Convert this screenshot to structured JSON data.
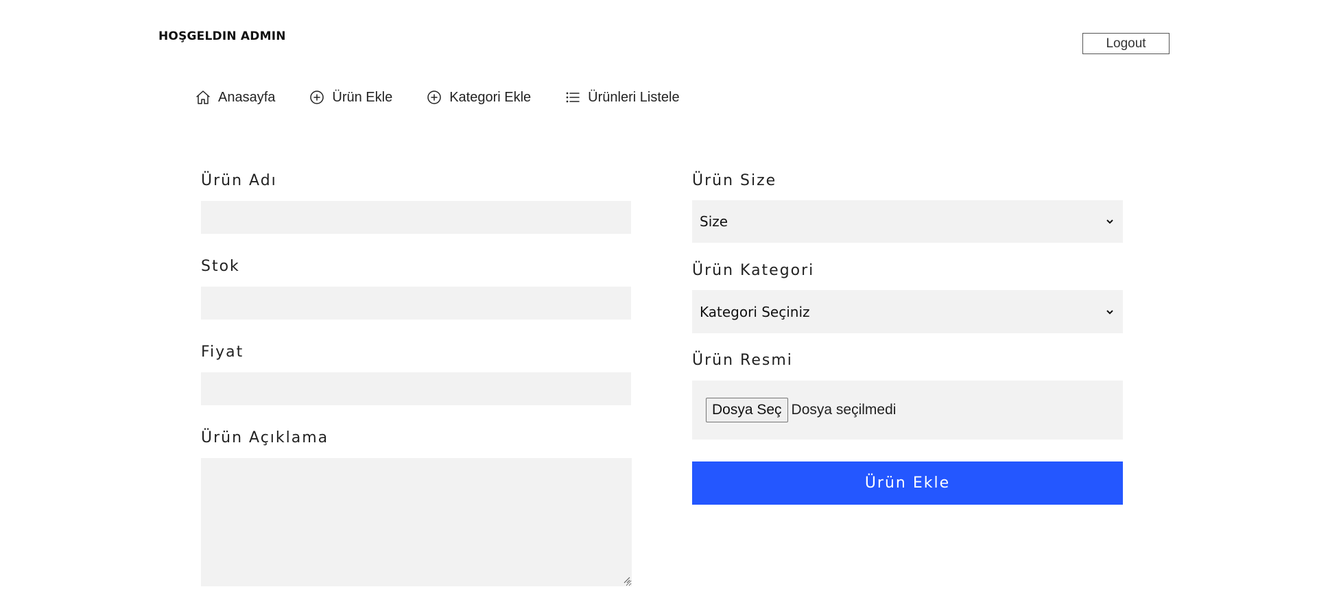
{
  "header": {
    "welcome": "HOŞGELDIN ADMIN",
    "logout_label": "Logout"
  },
  "nav": {
    "items": [
      {
        "label": "Anasayfa",
        "icon": "home-icon"
      },
      {
        "label": "Ürün Ekle",
        "icon": "plus-circle-icon"
      },
      {
        "label": "Kategori Ekle",
        "icon": "plus-circle-icon"
      },
      {
        "label": "Ürünleri Listele",
        "icon": "list-icon"
      }
    ]
  },
  "form": {
    "name_label": "Ürün Adı",
    "name_value": "",
    "stock_label": "Stok",
    "stock_value": "",
    "price_label": "Fiyat",
    "price_value": "",
    "description_label": "Ürün Açıklama",
    "description_value": "",
    "size_label": "Ürün Size",
    "size_selected": "Size",
    "category_label": "Ürün Kategori",
    "category_selected": "Kategori Seçiniz",
    "image_label": "Ürün Resmi",
    "file_button_label": "Dosya Seç",
    "file_status": "Dosya seçilmedi",
    "submit_label": "Ürün Ekle"
  },
  "colors": {
    "submit_bg": "#2457ff",
    "field_bg": "#f2f2f2"
  }
}
